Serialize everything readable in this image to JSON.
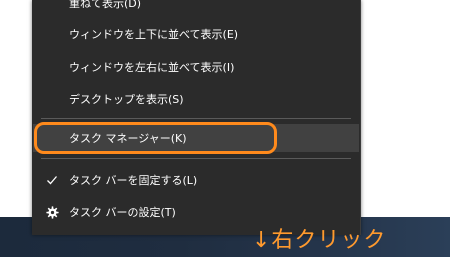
{
  "context_menu": {
    "items": [
      {
        "label": "重ねて表示(D)"
      },
      {
        "label": "ウィンドウを上下に並べて表示(E)"
      },
      {
        "label": "ウィンドウを左右に並べて表示(I)"
      },
      {
        "label": "デスクトップを表示(S)"
      },
      {
        "label": "タスク マネージャー(K)"
      },
      {
        "label": "タスク バーを固定する(L)",
        "icon": "checkmark-icon"
      },
      {
        "label": "タスク バーの設定(T)",
        "icon": "gear-icon"
      }
    ]
  },
  "annotation": {
    "hint_text": "↓右クリック",
    "highlight_color": "#ff8a1c"
  },
  "colors": {
    "menu_background": "#2b2b2b",
    "menu_text": "#ffffff",
    "hover_background": "#414141"
  }
}
